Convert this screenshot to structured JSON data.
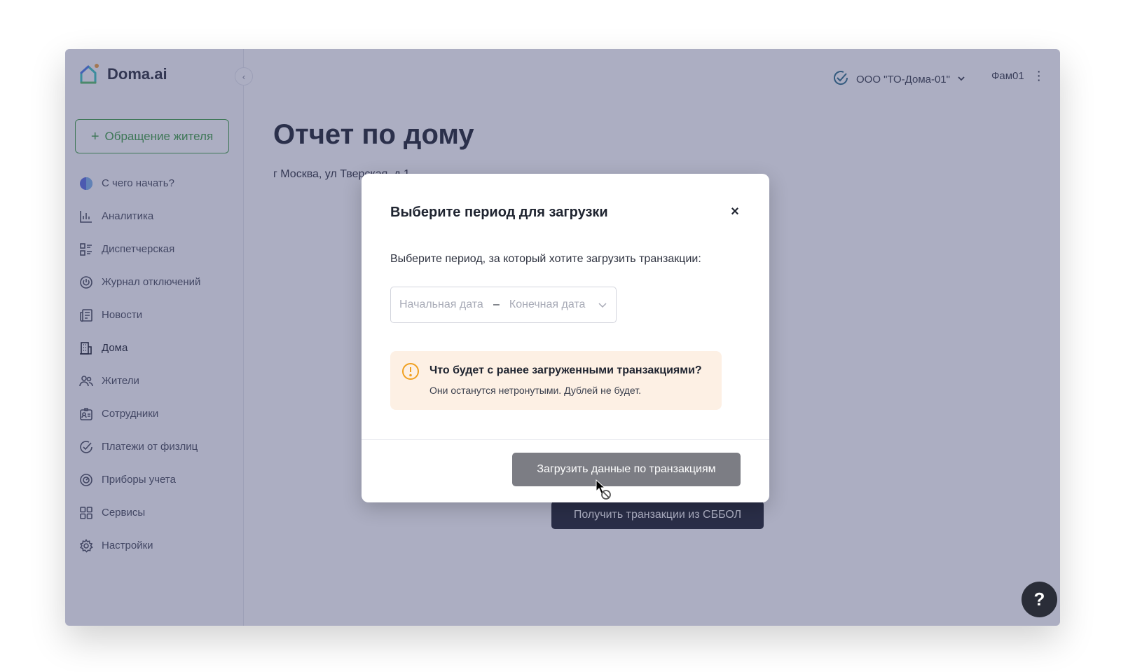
{
  "app": {
    "logo_text": "Doma.ai"
  },
  "sidebar": {
    "new_request_label": "Обращение жителя",
    "items": [
      {
        "label": "С чего начать?",
        "icon": "start-circle-icon"
      },
      {
        "label": "Аналитика",
        "icon": "bar-chart-icon"
      },
      {
        "label": "Диспетчерская",
        "icon": "dispatch-list-icon"
      },
      {
        "label": "Журнал отключений",
        "icon": "power-icon"
      },
      {
        "label": "Новости",
        "icon": "news-icon"
      },
      {
        "label": "Дома",
        "icon": "building-icon"
      },
      {
        "label": "Жители",
        "icon": "users-icon"
      },
      {
        "label": "Сотрудники",
        "icon": "employee-badge-icon"
      },
      {
        "label": "Платежи от физлиц",
        "icon": "check-circle-icon"
      },
      {
        "label": "Приборы учета",
        "icon": "meter-icon"
      },
      {
        "label": "Сервисы",
        "icon": "grid-icon"
      },
      {
        "label": "Настройки",
        "icon": "gear-icon"
      }
    ],
    "active_item": "Дома"
  },
  "topbar": {
    "org_name": "ООО \"ТО-Дома-01\"",
    "user_name": "Фам01"
  },
  "page": {
    "title": "Отчет по дому",
    "address": "г Москва, ул Тверская, д 1",
    "bg_action_label": "Получить транзакции из СББОЛ",
    "help_label": "?"
  },
  "modal": {
    "title": "Выберите период для загрузки",
    "close_label": "×",
    "description": "Выберите период, за который хотите загрузить транзакции:",
    "date_start_placeholder": "Начальная дата",
    "date_separator": "–",
    "date_end_placeholder": "Конечная дата",
    "warning_title": "Что будет с ранее загруженными транзакциями?",
    "warning_text": "Они останутся нетронутыми. Дублей не будет.",
    "submit_label": "Загрузить данные по транзакциям"
  },
  "colors": {
    "accent_green": "#43a047",
    "overlay": "#3a3f6e",
    "warning_bg": "#fdf0e4",
    "warning_icon": "#f0a020",
    "disabled_button": "#7c7d84"
  }
}
